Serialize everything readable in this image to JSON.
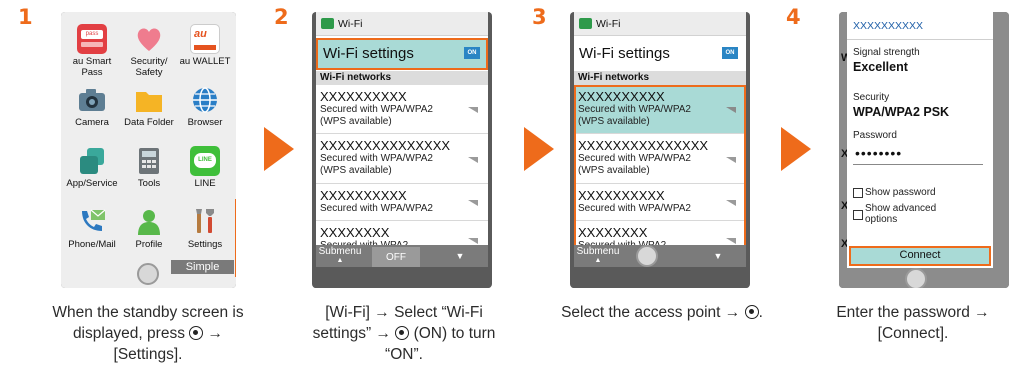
{
  "steps": [
    {
      "num": "1",
      "caption": [
        "When the standby screen is",
        "displayed, press ",
        " →",
        "[Settings]."
      ]
    },
    {
      "num": "2",
      "caption": [
        "[Wi-Fi] → Select “Wi-Fi",
        "settings” → ",
        " (ON) to turn",
        "“ON”."
      ]
    },
    {
      "num": "3",
      "caption": [
        "Select the access point → ",
        "."
      ]
    },
    {
      "num": "4",
      "caption": [
        "Enter the password →",
        "[Connect]."
      ]
    }
  ],
  "home": {
    "apps": [
      {
        "label": "au Smart Pass",
        "icon": "smart-pass-icon",
        "icon_text": "pass"
      },
      {
        "label": "Security/ Safety",
        "icon": "heart-shield-icon"
      },
      {
        "label": "au WALLET",
        "icon": "wallet-icon",
        "icon_text": "au"
      },
      {
        "label": "Camera",
        "icon": "camera-icon"
      },
      {
        "label": "Data Folder",
        "icon": "folder-icon"
      },
      {
        "label": "Browser",
        "icon": "globe-icon"
      },
      {
        "label": "App/Service",
        "icon": "apps-icon"
      },
      {
        "label": "Tools",
        "icon": "calculator-icon"
      },
      {
        "label": "LINE",
        "icon": "line-icon",
        "icon_text": "LINE"
      },
      {
        "label": "Phone/Mail",
        "icon": "phone-mail-icon"
      },
      {
        "label": "Profile",
        "icon": "person-icon"
      },
      {
        "label": "Settings",
        "icon": "tools-icon"
      }
    ],
    "simple_label": "Simple"
  },
  "wifi": {
    "title": "Wi-Fi",
    "settings_label": "Wi-Fi settings",
    "on_badge": "ON",
    "networks_header": "Wi-Fi networks",
    "networks": [
      {
        "ssid": "XXXXXXXXXX",
        "security": [
          "Secured with WPA/WPA2",
          "(WPS available)"
        ]
      },
      {
        "ssid": "XXXXXXXXXXXXXXX",
        "security": [
          "Secured with WPA/WPA2",
          "(WPS available)"
        ]
      },
      {
        "ssid": "XXXXXXXXXX",
        "security": [
          "Secured with WPA/WPA2"
        ]
      },
      {
        "ssid": "XXXXXXXX",
        "security": [
          "Secured with WPA2"
        ]
      }
    ],
    "bottom_bar": {
      "submenu": "Submenu",
      "off": "OFF"
    }
  },
  "dialog": {
    "title": "XXXXXXXXXX",
    "signal_label": "Signal strength",
    "signal_value": "Excellent",
    "security_label": "Security",
    "security_value": "WPA/WPA2 PSK",
    "password_label": "Password",
    "password_mask": "••••••••",
    "show_password": "Show password",
    "show_advanced": [
      "Show advanced",
      "options"
    ],
    "connect_label": "Connect"
  },
  "colors": {
    "accent": "#ee6b1b",
    "highlight": "#a9dad6",
    "badge": "#2a85c4"
  }
}
